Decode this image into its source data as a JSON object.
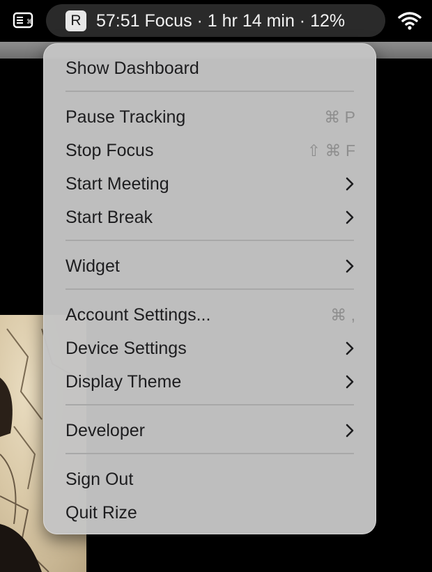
{
  "menubar": {
    "keyboard_icon": "keyboard-icon",
    "app_badge": "R",
    "status": "57:51 Focus · 1 hr 14 min · 12%",
    "wifi_icon": "wifi-icon"
  },
  "menu": {
    "show_dashboard": "Show Dashboard",
    "pause_tracking": {
      "label": "Pause Tracking",
      "shortcut": "⌘ P"
    },
    "stop_focus": {
      "label": "Stop Focus",
      "shortcut": "⇧ ⌘ F"
    },
    "start_meeting": "Start Meeting",
    "start_break": "Start Break",
    "widget": "Widget",
    "account_settings": {
      "label": "Account Settings...",
      "shortcut": "⌘ ,"
    },
    "device_settings": "Device Settings",
    "display_theme": "Display Theme",
    "developer": "Developer",
    "sign_out": "Sign Out",
    "quit": "Quit Rize"
  },
  "icons": {
    "submenu": "chevron-right-icon"
  },
  "colors": {
    "menu_bg": "#c4c4c4",
    "pill_bg": "#2a2a2a",
    "text": "#1d1d1f",
    "shortcut": "#8e8e8e"
  }
}
